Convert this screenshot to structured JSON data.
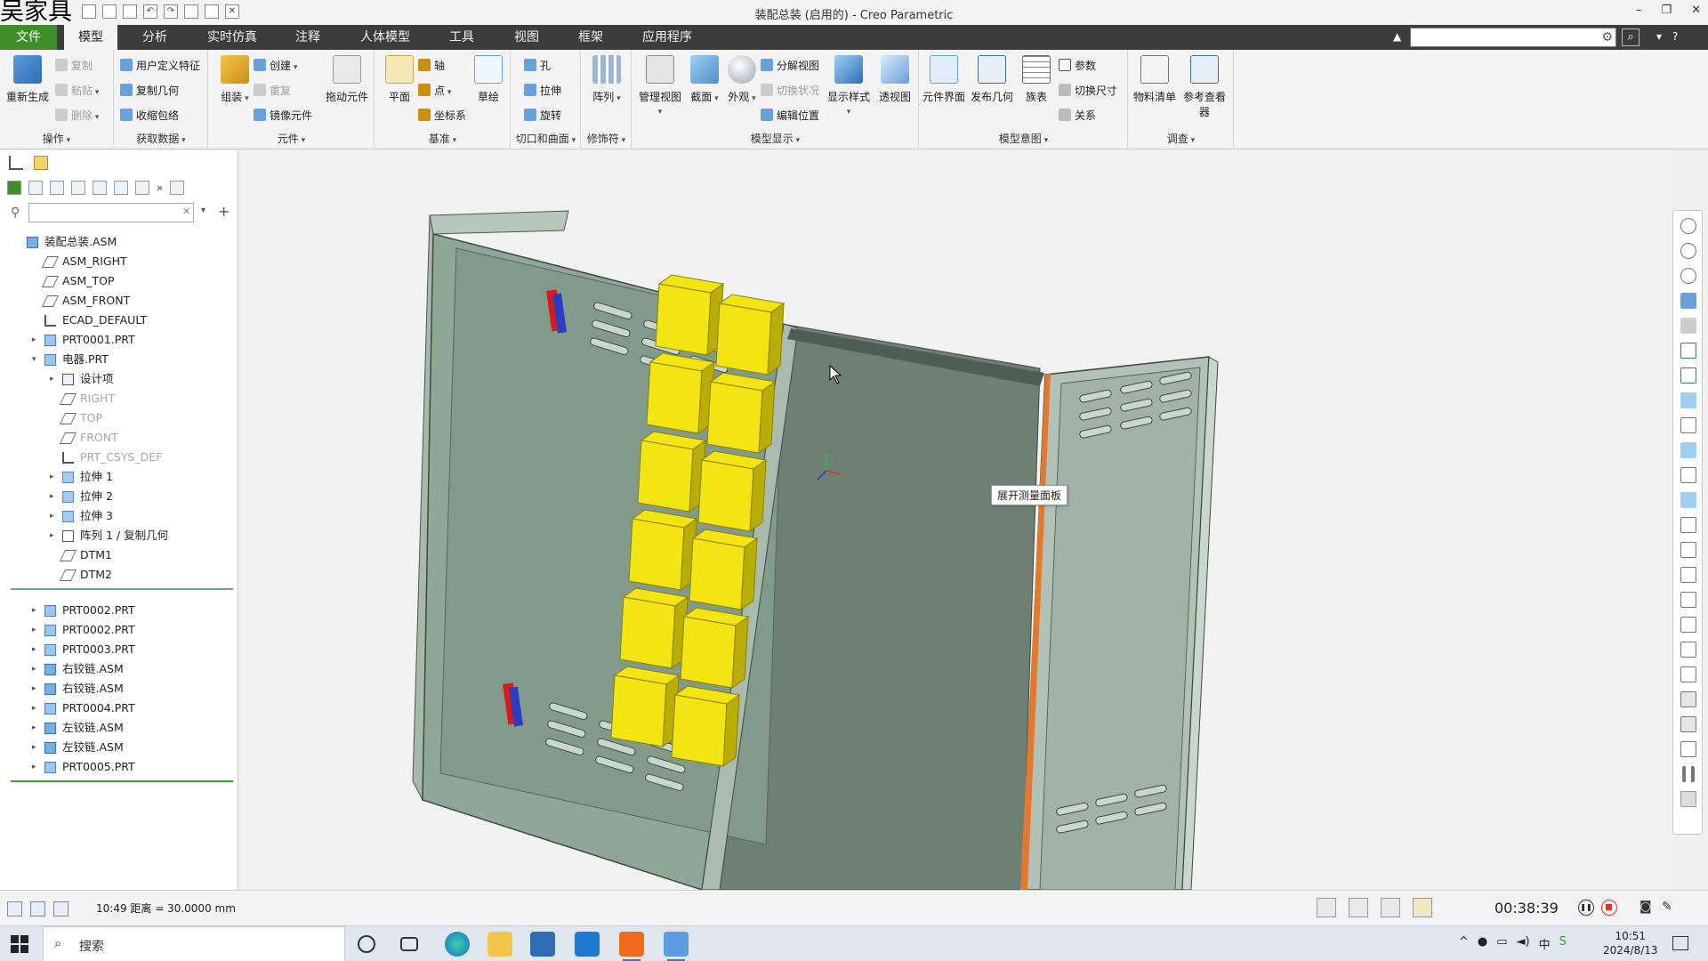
{
  "watermark": "吴家具",
  "window": {
    "title": "装配总装 (启用的) - Creo Parametric",
    "controls": [
      "–",
      "❐",
      "✕"
    ]
  },
  "menu": {
    "tabs": [
      "文件",
      "模型",
      "分析",
      "实时仿真",
      "注释",
      "人体模型",
      "工具",
      "视图",
      "框架",
      "应用程序"
    ],
    "active": "模型"
  },
  "ribbon": {
    "groups": {
      "operations": {
        "label": "操作",
        "regenerate": "重新生成",
        "copy": "复制",
        "paste": "粘贴",
        "delete": "删除"
      },
      "get_data": {
        "label": "获取数据",
        "udf": "用户定义特征",
        "copy_geom": "复制几何",
        "shrinkwrap": "收缩包络"
      },
      "components": {
        "label": "元件",
        "assemble": "组装",
        "create": "创建",
        "repeat": "重复",
        "mirror": "镜像元件",
        "drag": "拖动元件"
      },
      "datum": {
        "label": "基准",
        "plane": "平面",
        "axis": "轴",
        "point": "点",
        "csys": "坐标系",
        "sketch": "草绘"
      },
      "cut_surface": {
        "label": "切口和曲面",
        "hole": "孔",
        "extrude": "拉伸",
        "revolve": "旋转"
      },
      "modifiers": {
        "label": "修饰符",
        "pattern": "阵列"
      },
      "model_display": {
        "label": "模型显示",
        "manage_views": "管理视图",
        "section": "截面",
        "appearance": "外观",
        "exploded_view": "分解视图",
        "toggle_status": "切换状况",
        "edit_position": "编辑位置",
        "display_style": "显示样式",
        "perspective": "透视图"
      },
      "model_intent": {
        "label": "模型意图",
        "component_interface": "元件界面",
        "publish_geom": "发布几何",
        "family_table": "族表",
        "params": "参数",
        "switch_dims": "切换尺寸",
        "relations": "关系"
      },
      "investigate": {
        "label": "调查",
        "bom": "物料清单",
        "ref_viewer": "参考查看器"
      }
    }
  },
  "tree": {
    "filter_placeholder": "",
    "items": [
      {
        "label": "装配总装.ASM",
        "type": "asm",
        "level": 0,
        "expand": ""
      },
      {
        "label": "ASM_RIGHT",
        "type": "plane",
        "level": 1,
        "expand": ""
      },
      {
        "label": "ASM_TOP",
        "type": "plane",
        "level": 1,
        "expand": ""
      },
      {
        "label": "ASM_FRONT",
        "type": "plane",
        "level": 1,
        "expand": ""
      },
      {
        "label": "ECAD_DEFAULT",
        "type": "csys",
        "level": 1,
        "expand": ""
      },
      {
        "label": "PRT0001.PRT",
        "type": "prt",
        "level": 1,
        "expand": "▸"
      },
      {
        "label": "电器.PRT",
        "type": "prt",
        "level": 1,
        "expand": "▾"
      },
      {
        "label": "设计项",
        "type": "table",
        "level": 2,
        "expand": "▸"
      },
      {
        "label": "RIGHT",
        "type": "plane",
        "level": 2,
        "expand": "",
        "suppressed": true
      },
      {
        "label": "TOP",
        "type": "plane",
        "level": 2,
        "expand": "",
        "suppressed": true
      },
      {
        "label": "FRONT",
        "type": "plane",
        "level": 2,
        "expand": "",
        "suppressed": true
      },
      {
        "label": "PRT_CSYS_DEF",
        "type": "csys",
        "level": 2,
        "expand": "",
        "suppressed": true
      },
      {
        "label": "拉伸 1",
        "type": "feat",
        "level": 2,
        "expand": "▸"
      },
      {
        "label": "拉伸 2",
        "type": "feat",
        "level": 2,
        "expand": "▸"
      },
      {
        "label": "拉伸 3",
        "type": "feat",
        "level": 2,
        "expand": "▸"
      },
      {
        "label": "阵列 1 / 复制几何",
        "type": "pattern",
        "level": 2,
        "expand": "▸"
      },
      {
        "label": "DTM1",
        "type": "plane",
        "level": 2,
        "expand": ""
      },
      {
        "label": "DTM2",
        "type": "plane",
        "level": 2,
        "expand": ""
      }
    ],
    "items2": [
      {
        "label": "PRT0002.PRT",
        "type": "prt",
        "level": 1,
        "expand": "▸"
      },
      {
        "label": "PRT0002.PRT",
        "type": "prt",
        "level": 1,
        "expand": "▸"
      },
      {
        "label": "PRT0003.PRT",
        "type": "prt",
        "level": 1,
        "expand": "▸"
      },
      {
        "label": "右铰链.ASM",
        "type": "asm",
        "level": 1,
        "expand": "▸"
      },
      {
        "label": "右铰链.ASM",
        "type": "asm",
        "level": 1,
        "expand": "▸"
      },
      {
        "label": "PRT0004.PRT",
        "type": "prt",
        "level": 1,
        "expand": "▸"
      },
      {
        "label": "左铰链.ASM",
        "type": "asm",
        "level": 1,
        "expand": "▸"
      },
      {
        "label": "左铰链.ASM",
        "type": "asm",
        "level": 1,
        "expand": "▸"
      },
      {
        "label": "PRT0005.PRT",
        "type": "prt",
        "level": 1,
        "expand": "▸"
      }
    ]
  },
  "graphics": {
    "tooltip": "展开测量面板",
    "colors": {
      "cabinet": "#8ea796",
      "cabinet_dark": "#5f6f65",
      "module_yellow": "#f3e413",
      "module_shade": "#b9ad07",
      "hinge_red": "#d81b1b",
      "hinge_blue": "#2a3fc0",
      "edge_orange": "#e2792f"
    }
  },
  "status": {
    "message": "10:49 距离 = 30.0000 mm"
  },
  "recorder": {
    "timer": "00:38:39"
  },
  "taskbar": {
    "search_label": "搜索",
    "time": "10:51",
    "date": "2024/8/13",
    "ime": "中"
  }
}
